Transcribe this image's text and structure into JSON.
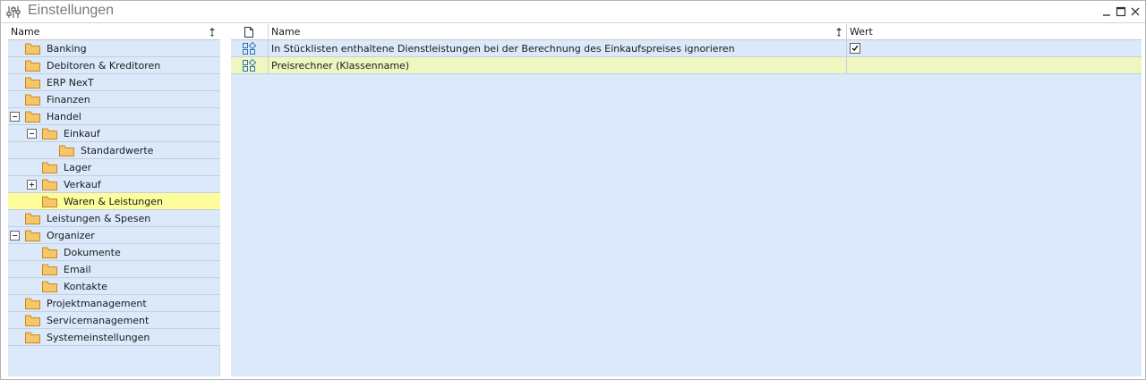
{
  "window": {
    "title": "Einstellungen",
    "title_icon": "settings-sliders-icon"
  },
  "tree": {
    "header": "Name",
    "items": [
      {
        "label": "Banking"
      },
      {
        "label": "Debitoren & Kreditoren"
      },
      {
        "label": "ERP NexT"
      },
      {
        "label": "Finanzen"
      },
      {
        "label": "Handel",
        "expander": "collapse"
      },
      {
        "label": "Einkauf",
        "expander": "collapse"
      },
      {
        "label": "Standardwerte"
      },
      {
        "label": "Lager"
      },
      {
        "label": "Verkauf",
        "expander": "expand"
      },
      {
        "label": "Waren & Leistungen",
        "selected": true
      },
      {
        "label": "Leistungen & Spesen"
      },
      {
        "label": "Organizer",
        "expander": "collapse"
      },
      {
        "label": "Dokumente"
      },
      {
        "label": "Email"
      },
      {
        "label": "Kontakte"
      },
      {
        "label": "Projektmanagement"
      },
      {
        "label": "Servicemanagement"
      },
      {
        "label": "Systemeinstellungen"
      }
    ]
  },
  "grid": {
    "columns": {
      "icon": "document-icon",
      "name": "Name",
      "value": "Wert"
    },
    "rows": [
      {
        "name": "In Stücklisten enthaltene Dienstleistungen bei der Berechnung des Einkaufspreises ignorieren",
        "value_checked": true
      },
      {
        "name": "Preisrechner (Klassenname)",
        "selected": true
      }
    ]
  },
  "colors": {
    "panel_bg": "#dbe9fb",
    "tree_selected": "#fdfd9c",
    "grid_selected": "#eff7c0",
    "folder": "#f5c66a"
  }
}
